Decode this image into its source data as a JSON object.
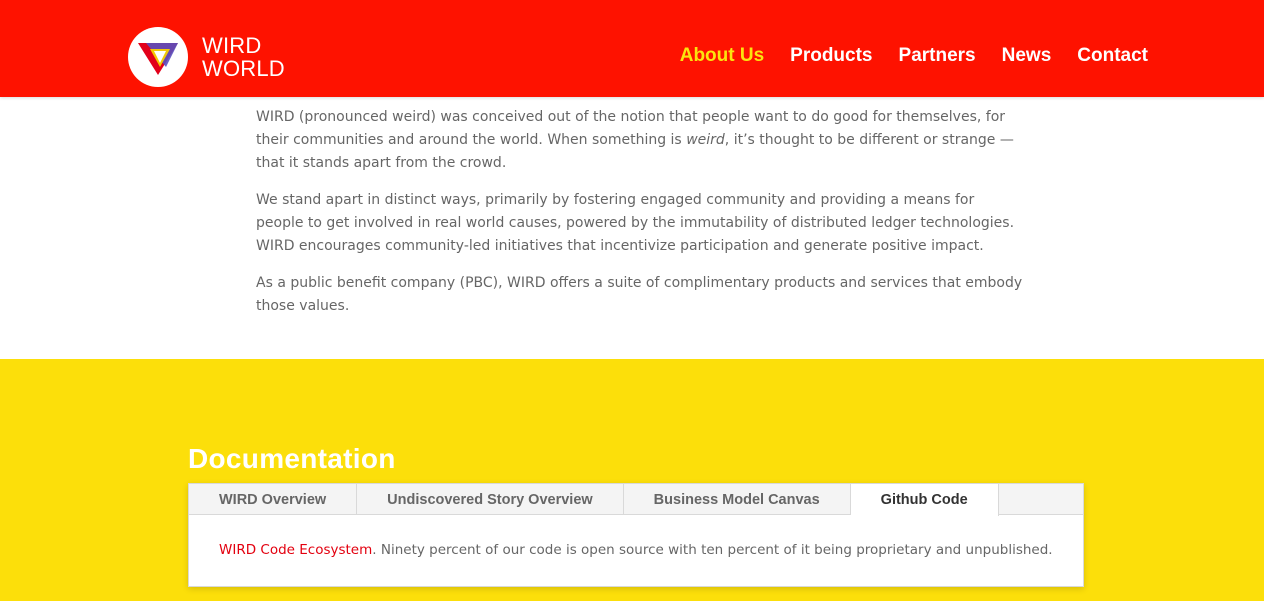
{
  "header": {
    "logo": {
      "line1": "WIRD",
      "line2": "WORLD",
      "icon": "wird-triangle-logo-icon"
    },
    "nav": [
      {
        "label": "About Us",
        "active": true
      },
      {
        "label": "Products",
        "active": false
      },
      {
        "label": "Partners",
        "active": false
      },
      {
        "label": "News",
        "active": false
      },
      {
        "label": "Contact",
        "active": false
      }
    ],
    "colors": {
      "background": "#fe1200",
      "active": "#fbe40e"
    }
  },
  "about": {
    "p1_before": "WIRD (pronounced weird) was conceived out of the notion that people want to do good for themselves, for their communities and around the world. When something is ",
    "p1_em": "weird",
    "p1_after": ", it’s thought to be different or strange — that it stands apart from the crowd.",
    "p2": "We stand apart in distinct ways, primarily by fostering engaged community and providing a means for people to get involved in real world causes, powered by the immutability of distributed ledger technologies. WIRD encourages community-led initiatives that incentivize participation and generate positive impact.",
    "p3": "As a public benefit company (PBC), WIRD offers a suite of complimentary products and services that embody those values."
  },
  "documentation": {
    "title": "Documentation",
    "background": "#fcdf0a",
    "tabs": [
      {
        "label": "WIRD Overview",
        "active": false
      },
      {
        "label": "Undiscovered Story Overview",
        "active": false
      },
      {
        "label": "Business Model Canvas",
        "active": false
      },
      {
        "label": "Github Code",
        "active": true
      }
    ],
    "content": {
      "link": "WIRD Code Ecosystem",
      "text": ".  Ninety percent of our code is open source with ten percent  of it being proprietary and unpublished."
    }
  }
}
